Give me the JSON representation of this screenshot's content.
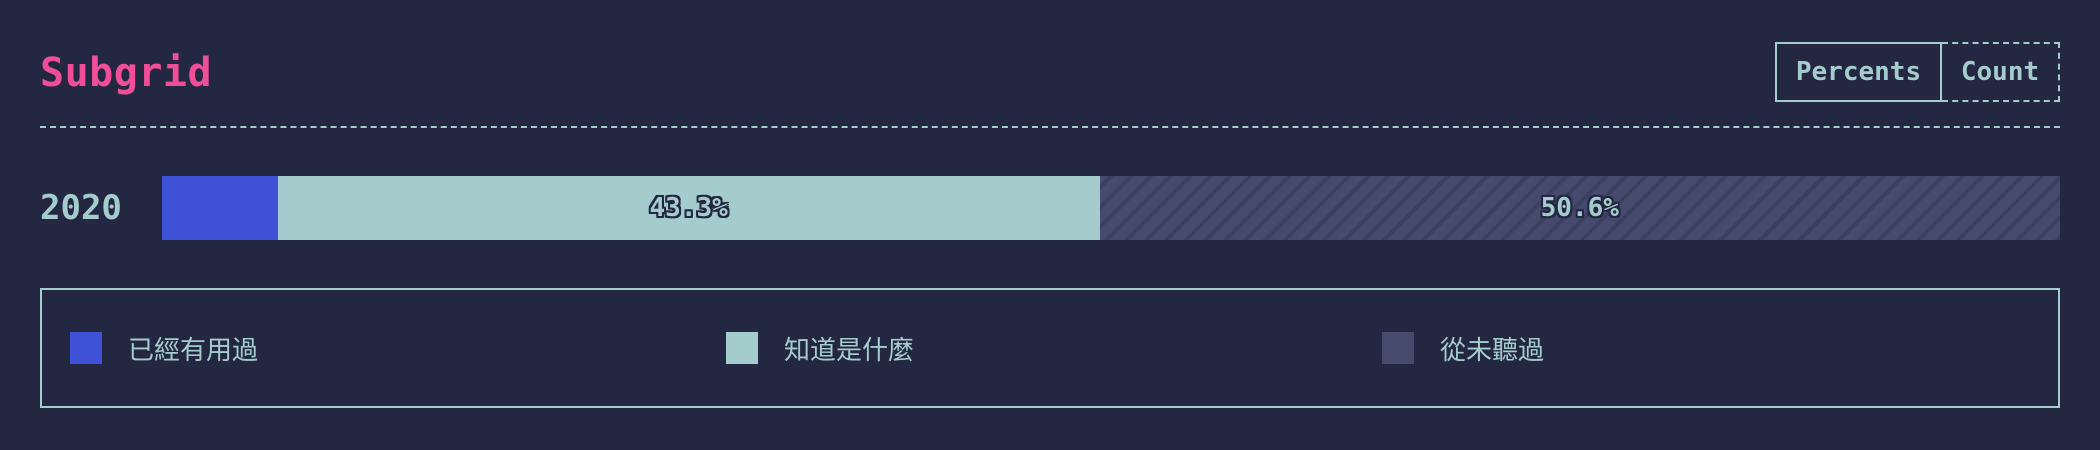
{
  "header": {
    "title": "Subgrid",
    "toggle": {
      "percents_label": "Percents",
      "count_label": "Count",
      "active": "Percents"
    }
  },
  "colors": {
    "background": "#232741",
    "title": "#f04e98",
    "text": "#a5cccd",
    "used": "#3f51d6",
    "heard": "#a5cccd",
    "never": "#464a6c"
  },
  "chart_data": {
    "type": "bar",
    "orientation": "horizontal",
    "stacked": true,
    "normalized": true,
    "categories": [
      "2020"
    ],
    "series": [
      {
        "name": "已經有用過",
        "values": [
          6.1
        ],
        "color": "#3f51d6",
        "show_label": false
      },
      {
        "name": "知道是什麼",
        "values": [
          43.3
        ],
        "color": "#a5cccd",
        "show_label": true
      },
      {
        "name": "從未聽過",
        "values": [
          50.6
        ],
        "color": "#464a6c",
        "show_label": true,
        "hatched": true
      }
    ],
    "value_format": "percent",
    "legend_position": "bottom",
    "xlim": [
      0,
      100
    ]
  },
  "legend": {
    "items": [
      {
        "label": "已經有用過",
        "color": "#3f51d6"
      },
      {
        "label": "知道是什麼",
        "color": "#a5cccd"
      },
      {
        "label": "從未聽過",
        "color": "#464a6c"
      }
    ]
  }
}
